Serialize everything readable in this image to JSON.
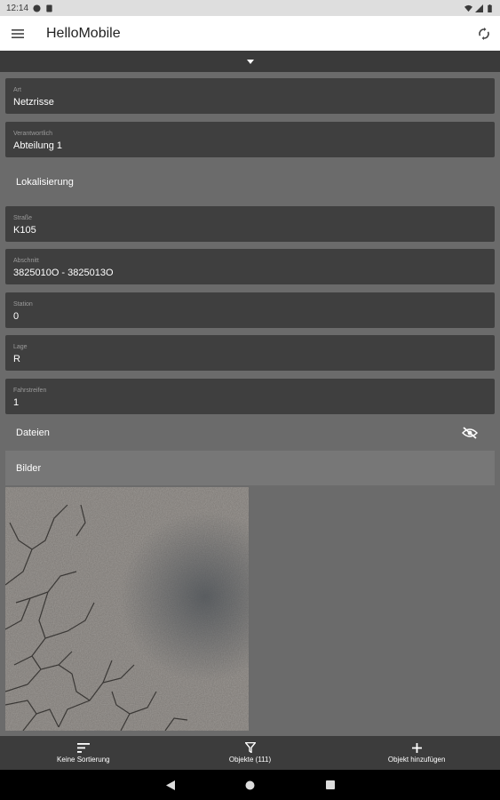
{
  "status_bar": {
    "time": "12:14"
  },
  "app_bar": {
    "title": "HelloMobile"
  },
  "fields": [
    {
      "label": "Art",
      "value": "Netzrisse"
    },
    {
      "label": "Verantwortlich",
      "value": "Abteilung 1"
    },
    {
      "label": "Straße",
      "value": "K105"
    },
    {
      "label": "Abschnitt",
      "value": "3825010O - 3825013O"
    },
    {
      "label": "Station",
      "value": "0"
    },
    {
      "label": "Lage",
      "value": "R"
    },
    {
      "label": "Fahrstreifen",
      "value": "1"
    }
  ],
  "sections": {
    "localization": "Lokalisierung",
    "files": "Dateien",
    "images": "Bilder"
  },
  "bottom_nav": [
    {
      "label": "Keine Sortierung",
      "icon": "sort-icon"
    },
    {
      "label": "Objekte (111)",
      "icon": "filter-icon"
    },
    {
      "label": "Objekt hinzufügen",
      "icon": "plus-icon"
    }
  ],
  "colors": {
    "background": "#6b6b6b",
    "field": "#3f3f3f",
    "app_bar": "#ffffff",
    "bottom_nav": "#3c3c3c"
  }
}
